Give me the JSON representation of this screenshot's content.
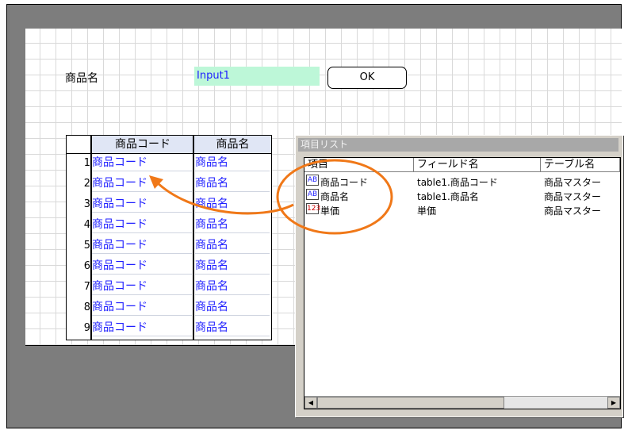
{
  "form": {
    "product_label": "商品名",
    "input1_value": "Input1",
    "ok_label": "OK"
  },
  "grid": {
    "headers": [
      "商品コード",
      "商品名"
    ],
    "rows": [
      {
        "num": "1",
        "code": "商品コード",
        "name": "商品名"
      },
      {
        "num": "2",
        "code": "商品コード",
        "name": "商品名"
      },
      {
        "num": "3",
        "code": "商品コード",
        "name": "商品名"
      },
      {
        "num": "4",
        "code": "商品コード",
        "name": "商品名"
      },
      {
        "num": "5",
        "code": "商品コード",
        "name": "商品名"
      },
      {
        "num": "6",
        "code": "商品コード",
        "name": "商品名"
      },
      {
        "num": "7",
        "code": "商品コード",
        "name": "商品名"
      },
      {
        "num": "8",
        "code": "商品コード",
        "name": "商品名"
      },
      {
        "num": "9",
        "code": "商品コード",
        "name": "商品名"
      }
    ]
  },
  "item_list": {
    "title": "項目リスト",
    "columns": [
      "項目",
      "フィールド名",
      "テーブル名"
    ],
    "items": [
      {
        "icon": "AB",
        "item": "商品コード",
        "field": "table1.商品コード",
        "table": "商品マスター"
      },
      {
        "icon": "AB",
        "item": "商品名",
        "field": "table1.商品名",
        "table": "商品マスター"
      },
      {
        "icon": "123",
        "item": "単価",
        "field": "単価",
        "table": "商品マスター"
      }
    ]
  },
  "colors": {
    "accent_orange": "#f07818",
    "link_blue": "#1e1eff",
    "input_bg": "#bdf7d8",
    "header_bg": "#e0e6f5"
  }
}
